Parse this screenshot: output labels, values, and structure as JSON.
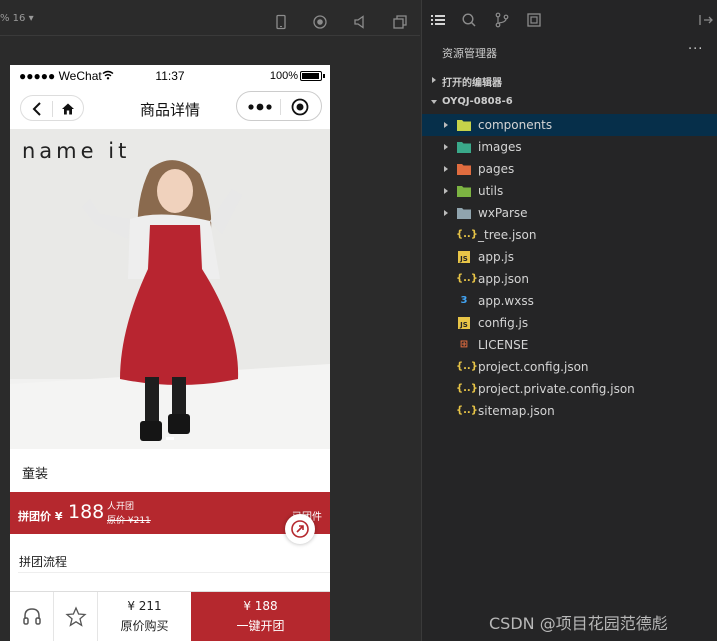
{
  "simulator_toolbar": {
    "zoom_label": "% 16 ▾"
  },
  "phone": {
    "status_bar": {
      "carrier": "●●●●● WeChat",
      "time": "11:37",
      "battery_text": "100%"
    },
    "nav": {
      "title": "商品详情"
    },
    "product": {
      "brand_logo": "name it",
      "name": "童装",
      "group_price_label": "拼团价 ¥",
      "group_price": "188",
      "group_people": "人开团",
      "original_price": "原价 ¥211",
      "group_count": "已团件"
    },
    "process_title": "拼团流程",
    "bottom_bar": {
      "original_price": "¥ 211",
      "original_label": "原价购买",
      "group_price": "¥ 188",
      "group_label": "一键开团"
    }
  },
  "explorer": {
    "title": "资源管理器",
    "more": "···",
    "sections": {
      "open_editors": "打开的编辑器",
      "project": "OYQJ-0808-6"
    },
    "tree": [
      {
        "label": "components",
        "kind": "folder",
        "icon": "folder-components-icon",
        "color": "#c5d34a"
      },
      {
        "label": "images",
        "kind": "folder",
        "icon": "folder-images-icon",
        "color": "#3aa98a"
      },
      {
        "label": "pages",
        "kind": "folder",
        "icon": "folder-pages-icon",
        "color": "#e06c3f"
      },
      {
        "label": "utils",
        "kind": "folder",
        "icon": "folder-utils-icon",
        "color": "#7cb342"
      },
      {
        "label": "wxParse",
        "kind": "folder",
        "icon": "folder-icon",
        "color": "#90a4ae"
      },
      {
        "label": "_tree.json",
        "kind": "file",
        "icon": "json-icon",
        "glyph": "{..}",
        "color": "#e8c547"
      },
      {
        "label": "app.js",
        "kind": "file",
        "icon": "js-icon",
        "glyph": "JS",
        "color": "#e8c547"
      },
      {
        "label": "app.json",
        "kind": "file",
        "icon": "json-icon",
        "glyph": "{..}",
        "color": "#e8c547"
      },
      {
        "label": "app.wxss",
        "kind": "file",
        "icon": "css-icon",
        "glyph": "3",
        "color": "#42a5f5"
      },
      {
        "label": "config.js",
        "kind": "file",
        "icon": "js-icon",
        "glyph": "JS",
        "color": "#e8c547"
      },
      {
        "label": "LICENSE",
        "kind": "file",
        "icon": "license-icon",
        "glyph": "⊞",
        "color": "#e06c3f"
      },
      {
        "label": "project.config.json",
        "kind": "file",
        "icon": "json-icon",
        "glyph": "{..}",
        "color": "#e8c547"
      },
      {
        "label": "project.private.config.json",
        "kind": "file",
        "icon": "json-icon",
        "glyph": "{..}",
        "color": "#e8c547"
      },
      {
        "label": "sitemap.json",
        "kind": "file",
        "icon": "json-icon",
        "glyph": "{..}",
        "color": "#e8c547"
      }
    ],
    "selected_index": 0
  },
  "watermark": "CSDN @项目花园范德彪"
}
